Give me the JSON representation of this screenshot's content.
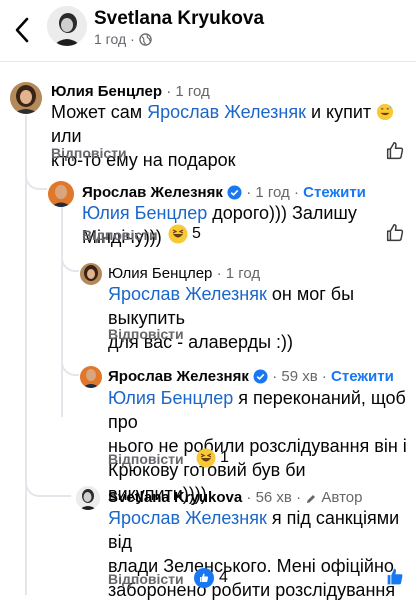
{
  "header": {
    "name": "Svetlana Kryukova",
    "time": "1 год",
    "visibility": "globe-icon"
  },
  "comments": [
    {
      "author": "Юлия Бенцлер",
      "time": "1 год",
      "text_before": "Может сам ",
      "mention": "Ярослав Железняк",
      "text_after": " и купит",
      "text_line2": "кто-то ему на подарок",
      "text_after2": " или",
      "reply": "Відповісти"
    },
    {
      "author": "Ярослав Железняк",
      "time": "1 год",
      "follow": "Стежити",
      "mention": "Юлия Бенцлер",
      "text_after": " дорого))) Залишу Міндічу)))",
      "reply": "Відповісти",
      "reaction_count": "5"
    },
    {
      "author": "Юлия Бенцлер",
      "time": "1 год",
      "mention": "Ярослав Железняк",
      "text_after": " он мог бы выкупить",
      "text_line2": "для вас - алаверды :))",
      "reply": "Відповісти"
    },
    {
      "author": "Ярослав Железняк",
      "time": "59 хв",
      "follow": "Стежити",
      "mention": "Юлия Бенцлер",
      "text_after": " я переконаний, щоб про",
      "text_line2": "нього не робили розслідування він і",
      "text_line3": "Крюкову готовий був би викупити))))",
      "reply": "Відповісти",
      "reaction_count": "1"
    },
    {
      "author": "Svetlana Kryukova",
      "time": "56 хв",
      "author_badge": "Автор",
      "mention": "Ярослав Железняк",
      "text_after": " я під санкціями від",
      "text_line2": "влади Зеленського. Мені офіційно",
      "text_line3": "заборонено робити розслідування",
      "reply": "Відповісти",
      "reaction_count": "4"
    }
  ],
  "colors": {
    "accent": "#1877f2",
    "mention": "#1b66c9",
    "muted": "#65676b",
    "thread": "#e4e6eb"
  }
}
